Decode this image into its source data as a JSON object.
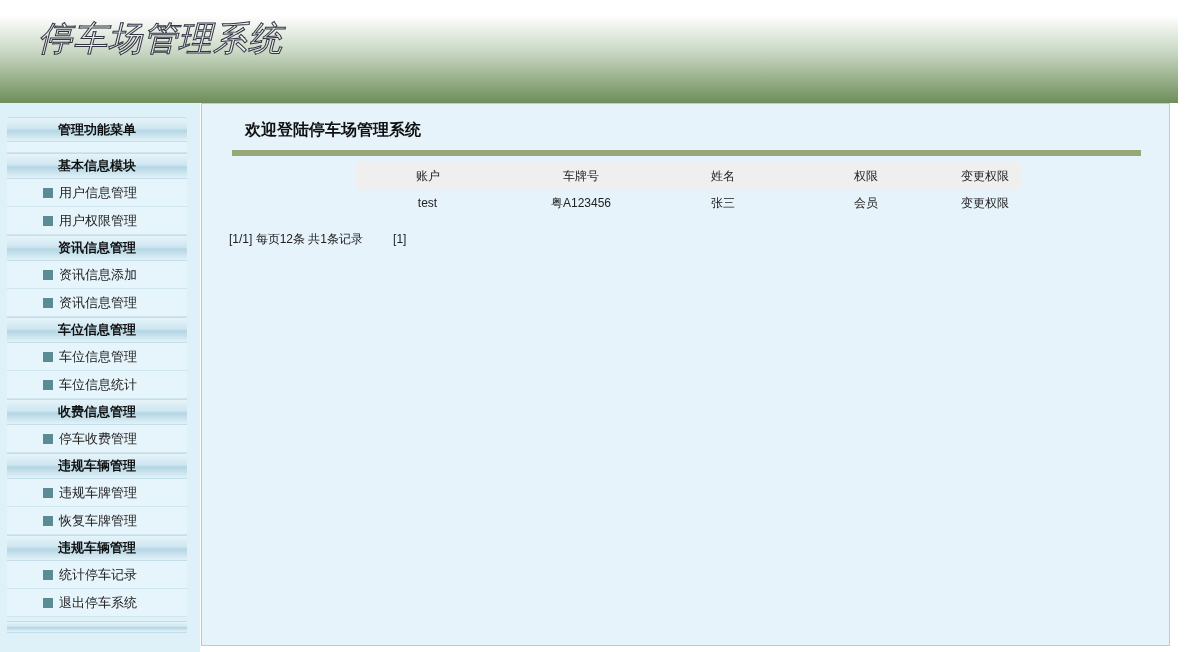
{
  "header": {
    "title": "停车场管理系统"
  },
  "sidebar": {
    "title": "管理功能菜单",
    "groups": [
      {
        "title": "基本信息模块",
        "items": [
          "用户信息管理",
          "用户权限管理"
        ]
      },
      {
        "title": "资讯信息管理",
        "items": [
          "资讯信息添加",
          "资讯信息管理"
        ]
      },
      {
        "title": "车位信息管理",
        "items": [
          "车位信息管理",
          "车位信息统计"
        ]
      },
      {
        "title": "收费信息管理",
        "items": [
          "停车收费管理"
        ]
      },
      {
        "title": "违规车辆管理",
        "items": [
          "违规车牌管理",
          "恢复车牌管理"
        ]
      },
      {
        "title": "违规车辆管理",
        "items": [
          "统计停车记录",
          "退出停车系统"
        ]
      }
    ]
  },
  "main": {
    "heading": "欢迎登陆停车场管理系统"
  },
  "table": {
    "columns": [
      "账户",
      "车牌号",
      "姓名",
      "权限",
      "变更权限"
    ],
    "rows": [
      {
        "cells": [
          "test",
          "粤A123456",
          "张三",
          "会员"
        ],
        "action": "变更权限"
      }
    ]
  },
  "pagination": {
    "summary": "[1/1] 每页12条 共1条记录",
    "pages": [
      "[1]"
    ]
  }
}
